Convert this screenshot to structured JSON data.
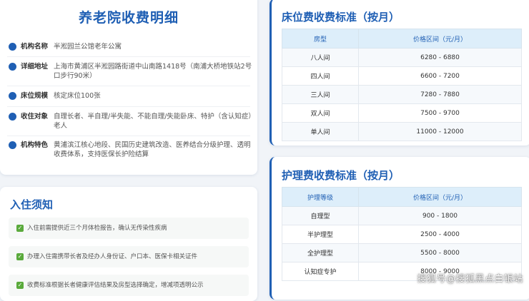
{
  "info": {
    "title": "养老院收费明细",
    "rows": [
      {
        "label": "机构名称",
        "value": "半淞园兰公馆老年公寓"
      },
      {
        "label": "详细地址",
        "value": "上海市黄浦区半淞园路街道中山南路1418号（南浦大桥地铁站2号口步行90米）"
      },
      {
        "label": "床位规模",
        "value": "核定床位100张"
      },
      {
        "label": "收住对象",
        "value": "自理长者、半自理/半失能、不能自理/失能卧床、特护（含认知症）老人"
      },
      {
        "label": "机构特色",
        "value": "黄浦滨江核心地段、民国历史建筑改造、医养结合分级护理、透明收费体系，支持医保长护险结算"
      }
    ]
  },
  "notice": {
    "title": "入住须知",
    "items": [
      "入住前需提供近三个月体检报告，确认无传染性疾病",
      "办理入住需携带长者及经办人身份证、户口本、医保卡相关证件",
      "收费标准根据长者健康评估结果及房型选择确定，增减项透明公示"
    ]
  },
  "bed": {
    "title": "床位费收费标准（按月）",
    "headers": [
      "房型",
      "价格区间（元/月）"
    ],
    "rows": [
      [
        "八人间",
        "6280 - 6880"
      ],
      [
        "四人间",
        "6600 - 7200"
      ],
      [
        "三人间",
        "7280 - 7880"
      ],
      [
        "双人间",
        "7500 - 9700"
      ],
      [
        "单人间",
        "11000 - 12000"
      ]
    ]
  },
  "care": {
    "title": "护理费收费标准（按月）",
    "headers": [
      "护理等级",
      "价格区间（元/月）"
    ],
    "rows": [
      [
        "自理型",
        "900 - 1800"
      ],
      [
        "半护理型",
        "2500 - 4000"
      ],
      [
        "全护理型",
        "5500 - 8000"
      ],
      [
        "认知症专护",
        "8000 - 9000"
      ]
    ]
  },
  "watermark": "搜狐号@搜狐黑点白银站",
  "colors": {
    "accent": "#1f5fb4",
    "check": "#5aaa3c",
    "table_header": "#ddeefa"
  }
}
